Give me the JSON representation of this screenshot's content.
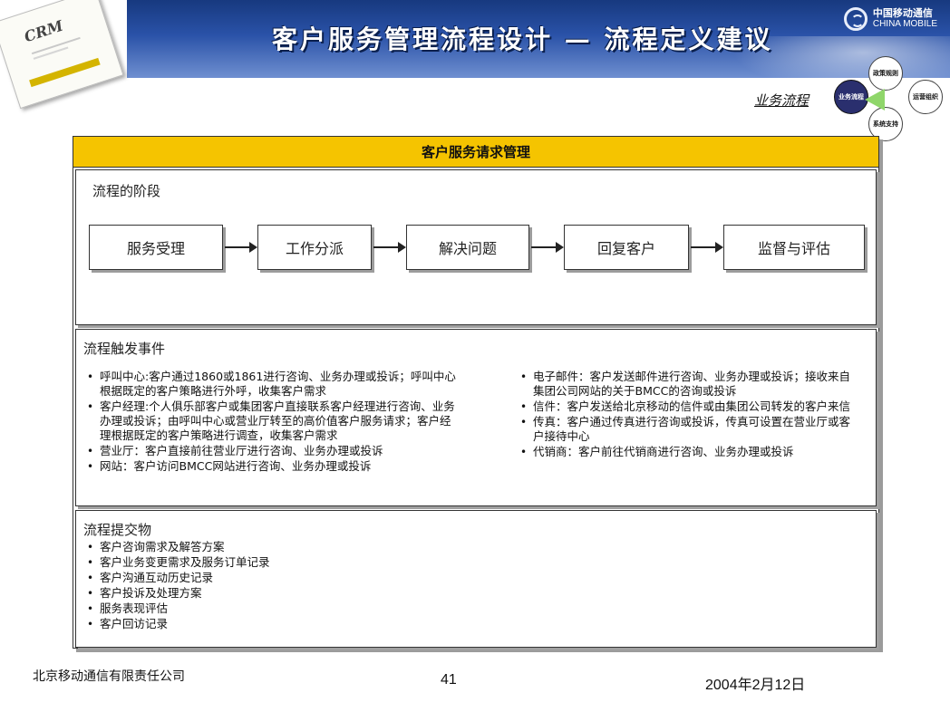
{
  "header": {
    "title": "客户服务管理流程设计 — 流程定义建议",
    "brand_cn": "中国移动通信",
    "brand_en": "CHINA MOBILE",
    "colors": {
      "band": "#2a52a8",
      "panel_header": "#f5c400"
    }
  },
  "thumbnail": {
    "label": "CRM"
  },
  "context": {
    "label": "业务流程",
    "nodes": {
      "policy": "政策规则",
      "business": "业务流程",
      "operations": "运营组织",
      "system": "系统支持"
    }
  },
  "panel": {
    "title": "客户服务请求管理",
    "stages_section": {
      "title": "流程的阶段",
      "stages": [
        "服务受理",
        "工作分派",
        "解决问题",
        "回复客户",
        "监督与评估"
      ]
    },
    "triggers_section": {
      "title": "流程触发事件",
      "left": [
        "呼叫中心:客户通过1860或1861进行咨询、业务办理或投诉；呼叫中心根据既定的客户策略进行外呼，收集客户需求",
        "客户经理:个人俱乐部客户或集团客户直接联系客户经理进行咨询、业务办理或投诉；由呼叫中心或营业厅转至的高价值客户服务请求；客户经理根据既定的客户策略进行调查，收集客户需求",
        "营业厅：客户直接前往营业厅进行咨询、业务办理或投诉",
        "网站：客户访问BMCC网站进行咨询、业务办理或投诉"
      ],
      "right": [
        "电子邮件：客户发送邮件进行咨询、业务办理或投诉；接收来自集团公司网站的关于BMCC的咨询或投诉",
        "信件：客户发送给北京移动的信件或由集团公司转发的客户来信",
        "传真：客户通过传真进行咨询或投诉，传真可设置在营业厅或客户接待中心",
        "代销商：客户前往代销商进行咨询、业务办理或投诉"
      ]
    },
    "deliverables_section": {
      "title": "流程提交物",
      "items": [
        "客户咨询需求及解答方案",
        "客户业务变更需求及服务订单记录",
        "客户沟通互动历史记录",
        "客户投诉及处理方案",
        "服务表现评估",
        "客户回访记录"
      ]
    }
  },
  "footer": {
    "company": "北京移动通信有限责任公司",
    "page": "41",
    "date": "2004年2月12日"
  }
}
